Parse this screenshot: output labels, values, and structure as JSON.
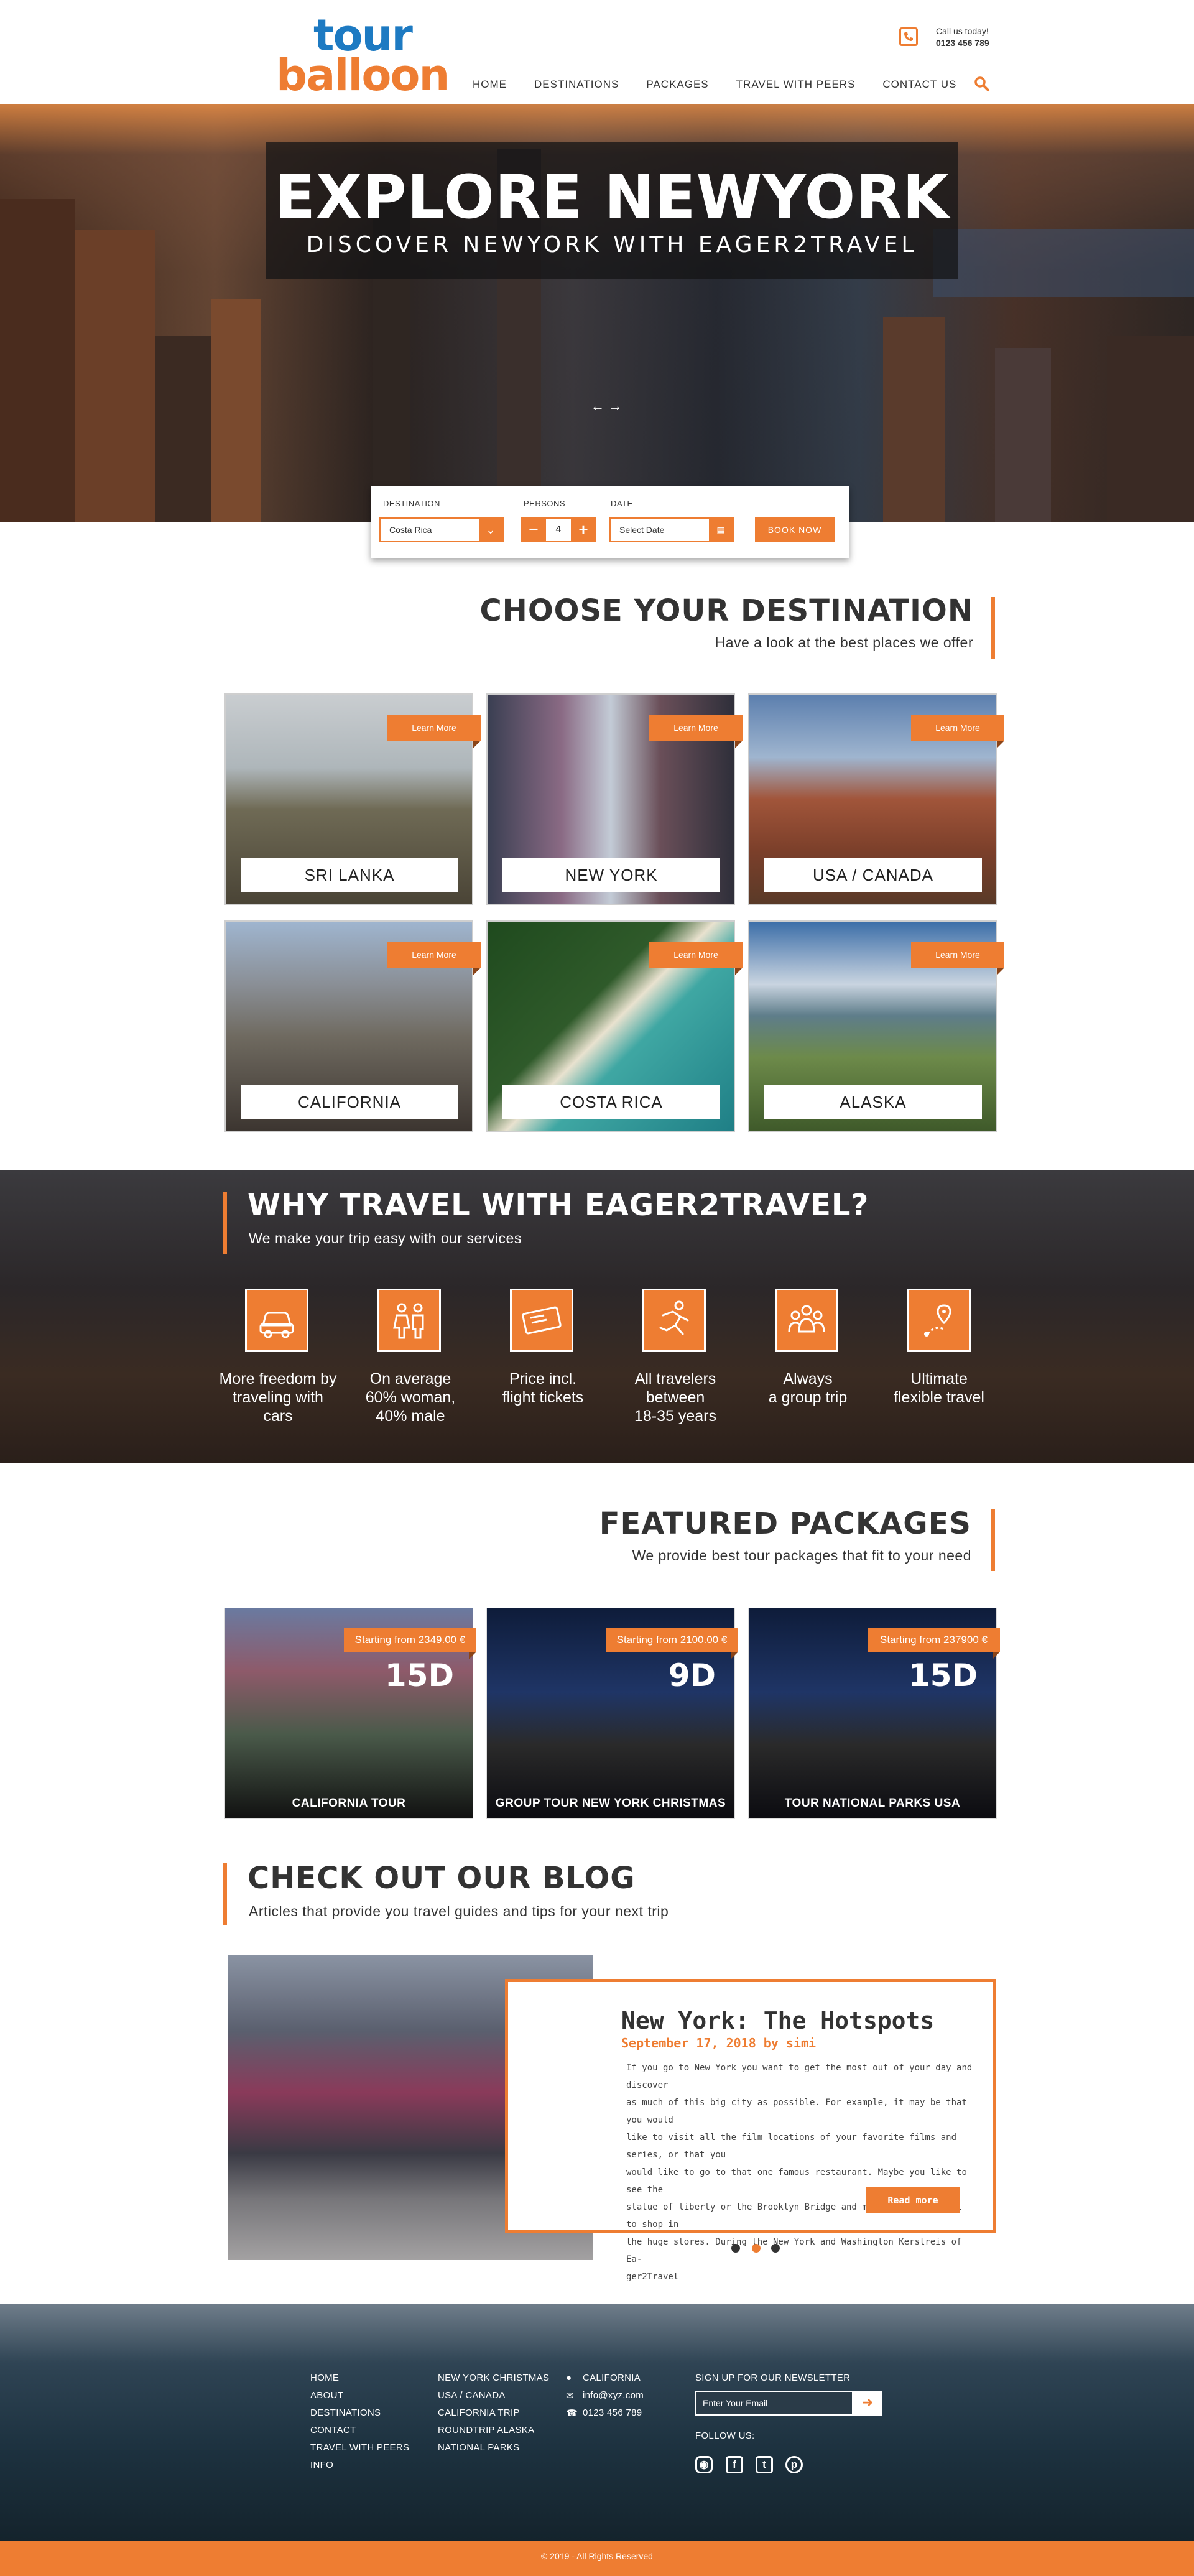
{
  "brand": {
    "line1": "tour",
    "line2": "balloon",
    "accent": "#ee7d32",
    "blue": "#1d7ac2"
  },
  "header": {
    "call_label": "Call us today!",
    "call_number": "0123 456 789",
    "nav": [
      "HOME",
      "DESTINATIONS",
      "PACKAGES",
      "TRAVEL WITH PEERS",
      "CONTACT  US"
    ]
  },
  "hero": {
    "title": "EXPLORE NEWYORK",
    "subtitle": "DISCOVER NEWYORK WITH EAGER2TRAVEL",
    "arrows": "← →"
  },
  "booking": {
    "destination_label": "DESTINATION",
    "destination_value": "Costa Rica",
    "persons_label": "PERSONS",
    "persons_value": "4",
    "minus": "−",
    "plus": "+",
    "date_label": "DATE",
    "date_placeholder": "Select Date",
    "book_button": "BOOK NOW"
  },
  "destinations": {
    "title": "CHOOSE YOUR DESTINATION",
    "subtitle": "Have a look at the best places we offer",
    "learn_more": "Learn More",
    "items": [
      "SRI LANKA",
      "NEW YORK",
      "USA / CANADA",
      "CALIFORNIA",
      "COSTA RICA",
      "ALASKA"
    ]
  },
  "why": {
    "title": "WHY TRAVEL WITH EAGER2TRAVEL?",
    "subtitle": "We make your trip easy with our services",
    "items": [
      {
        "icon": "car-icon",
        "line1": "More freedom by",
        "line2": "traveling with",
        "line3": "cars"
      },
      {
        "icon": "people-gender-icon",
        "line1": "On average",
        "line2": "60% woman,",
        "line3": "40% male"
      },
      {
        "icon": "ticket-icon",
        "line1": "Price incl.",
        "line2": "flight tickets",
        "line3": ""
      },
      {
        "icon": "runner-icon",
        "line1": "All travelers",
        "line2": "between",
        "line3": "18-35 years"
      },
      {
        "icon": "group-icon",
        "line1": "Always",
        "line2": "a group trip",
        "line3": ""
      },
      {
        "icon": "location-route-icon",
        "line1": "Ultimate",
        "line2": "flexible travel",
        "line3": ""
      }
    ]
  },
  "packages": {
    "title": "FEATURED PACKAGES",
    "subtitle": "We provide best tour packages that fit to your need",
    "items": [
      {
        "price": "Starting from 2349.00 €",
        "days": "15D",
        "name": "CALIFORNIA TOUR"
      },
      {
        "price": "Starting from 2100.00 €",
        "days": "9D",
        "name": "GROUP TOUR NEW YORK CHRISTMAS"
      },
      {
        "price": "Starting from 237900 €",
        "days": "15D",
        "name": "TOUR NATIONAL PARKS USA"
      }
    ]
  },
  "blog": {
    "title": "CHECK OUT OUR BLOG",
    "subtitle": "Articles that provide you travel guides and tips for your next trip",
    "post_title": "New York: The Hotspots",
    "post_date": "September 17, 2018 by simi",
    "post_lines": [
      "If you go to New York you want to get the most out of your day and discover",
      "as much of this big city as possible. For example, it may be that you would",
      "like to visit all the film locations of your favorite films and series, or that you",
      "would like to go to that one famous restaurant. Maybe you like to see the",
      "statue of liberty or the Brooklyn Bridge and maybe you just want to shop in",
      "the huge stores. During the New York and Washington Kerstreis of Ea-",
      "ger2Travel"
    ],
    "read_more": "Read more"
  },
  "footer": {
    "col1": [
      "HOME",
      "ABOUT",
      "DESTINATIONS",
      "CONTACT",
      "TRAVEL WITH PEERS",
      "INFO"
    ],
    "col2": [
      "NEW YORK CHRISTMAS",
      "USA / CANADA",
      "CALIFORNIA TRIP",
      "ROUNDTRIP ALASKA",
      "NATIONAL PARKS"
    ],
    "contact": {
      "location": "CALIFORNIA",
      "email": "info@xyz.com",
      "phone": "0123 456 789"
    },
    "newsletter_label": "SIGN UP FOR OUR NEWSLETTER",
    "newsletter_placeholder": "Enter Your Email",
    "follow_label": "FOLLOW US:",
    "copyright": "© 2019 - All Rights Reserved"
  }
}
